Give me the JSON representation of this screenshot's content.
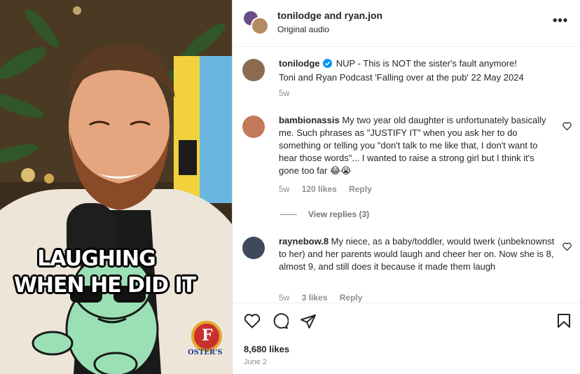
{
  "post": {
    "header_user": "tonilodge and ryan.jon",
    "header_audio": "Original audio",
    "more_label": "•••"
  },
  "media": {
    "caption_line1": "LAUGHING",
    "caption_line2": "WHEN HE DID IT",
    "patch_text": "OSTER'S",
    "patch_letter": "F"
  },
  "comments": [
    {
      "user": "tonilodge",
      "verified": true,
      "text": "NUP - This is NOT the sister's fault anymore!",
      "text2": "Toni and Ryan Podcast 'Falling over at the pub' 22 May 2024",
      "time": "5w"
    },
    {
      "user": "bambionassis",
      "text": "My two year old daughter is unfortunately basically me. Such phrases as \"JUSTIFY IT\" when you ask her to do something or telling you \"don't talk to me like that, I don't want to hear those words\"... I wanted to raise a strong girl but I think it's gone too far 😂😭",
      "time": "5w",
      "likes": "120 likes",
      "reply": "Reply",
      "view_replies": "View replies (3)"
    },
    {
      "user": "raynebow.8",
      "text": "My niece, as a baby/toddler, would twerk (unbeknownst to her) and her parents would laugh and cheer her on. Now she is 8, almost 9, and still does it because it made them laugh",
      "time": "5w",
      "likes": "3 likes",
      "reply": "Reply"
    }
  ],
  "footer": {
    "likes": "8,680 likes",
    "date": "June 2"
  },
  "colors": {
    "verified": "#0095f6",
    "meta": "#8e8e8e",
    "text": "#262626"
  }
}
